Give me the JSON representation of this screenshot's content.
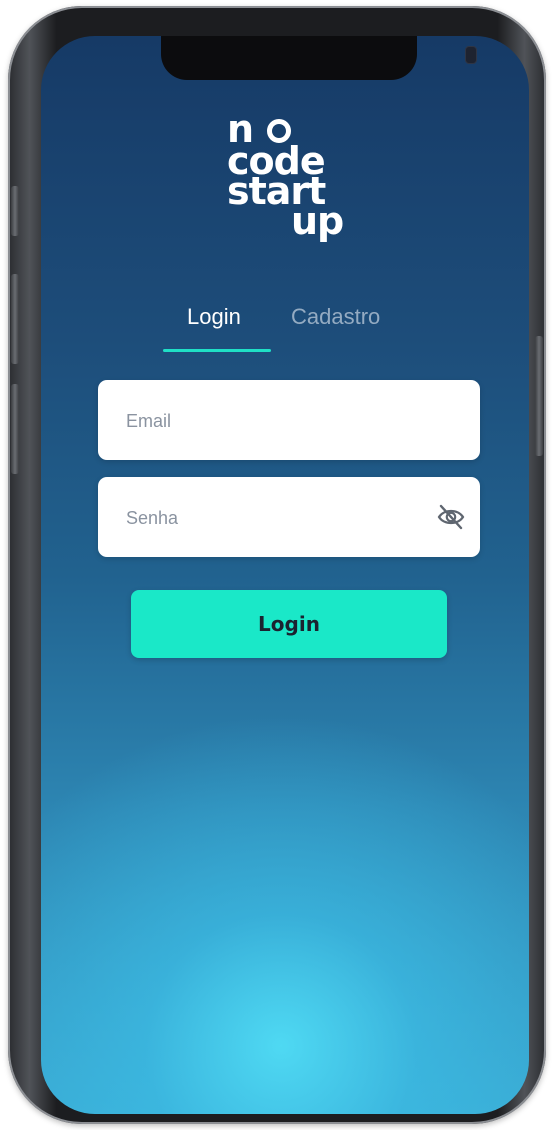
{
  "logo": {
    "line1": "n",
    "line2": "code",
    "line3": "start",
    "line4": "up"
  },
  "tabs": [
    {
      "label": "Login",
      "active": true
    },
    {
      "label": "Cadastro",
      "active": false
    }
  ],
  "form": {
    "email_placeholder": "Email",
    "password_placeholder": "Senha",
    "submit_label": "Login"
  },
  "colors": {
    "accent": "#1ae8c8",
    "underline": "#1fe0c6",
    "background_top": "#163a66",
    "background_bottom": "#3aa9d2"
  },
  "icons": {
    "password_toggle": "eye-off-icon"
  }
}
